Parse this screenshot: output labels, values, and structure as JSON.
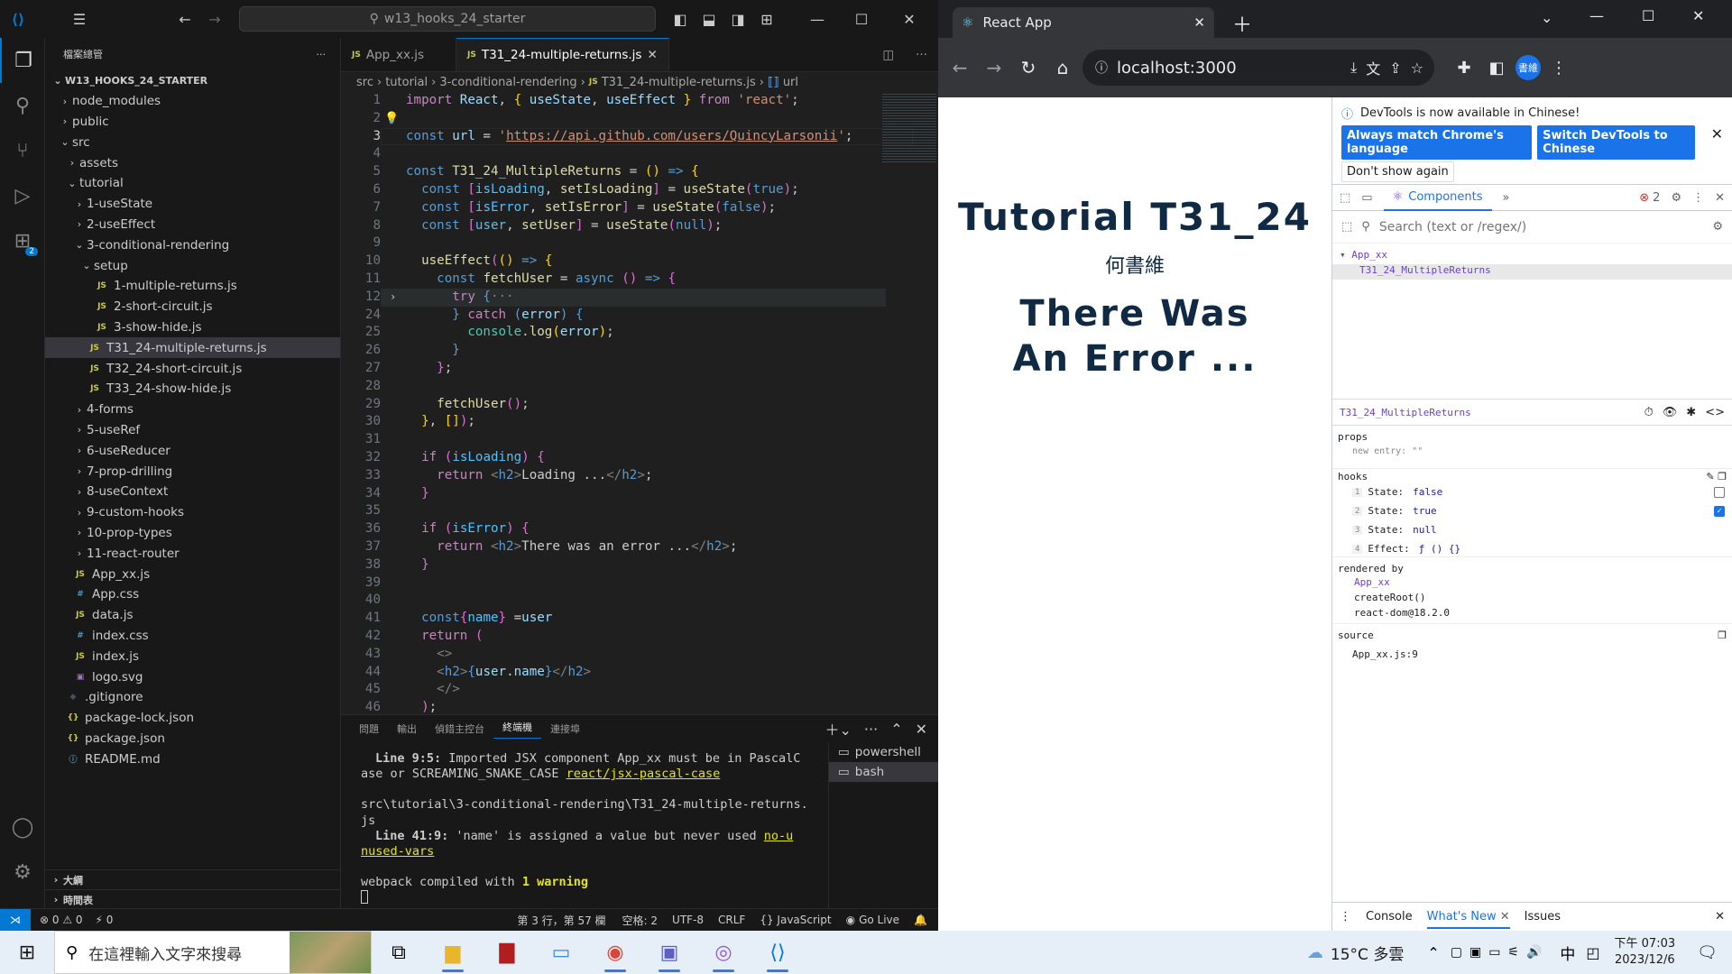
{
  "vscode": {
    "search": "w13_hooks_24_starter",
    "explorer_title": "檔案總管",
    "project": "W13_HOOKS_24_STARTER",
    "tree": [
      {
        "label": "node_modules",
        "indent": 1,
        "type": "folder",
        "open": false
      },
      {
        "label": "public",
        "indent": 1,
        "type": "folder",
        "open": false
      },
      {
        "label": "src",
        "indent": 1,
        "type": "folder",
        "open": true
      },
      {
        "label": "assets",
        "indent": 2,
        "type": "folder",
        "open": false
      },
      {
        "label": "tutorial",
        "indent": 2,
        "type": "folder",
        "open": true
      },
      {
        "label": "1-useState",
        "indent": 3,
        "type": "folder",
        "open": false
      },
      {
        "label": "2-useEffect",
        "indent": 3,
        "type": "folder",
        "open": false
      },
      {
        "label": "3-conditional-rendering",
        "indent": 3,
        "type": "folder",
        "open": true
      },
      {
        "label": "setup",
        "indent": 4,
        "type": "folder",
        "open": true
      },
      {
        "label": "1-multiple-returns.js",
        "indent": 5,
        "type": "js"
      },
      {
        "label": "2-short-circuit.js",
        "indent": 5,
        "type": "js"
      },
      {
        "label": "3-show-hide.js",
        "indent": 5,
        "type": "js"
      },
      {
        "label": "T31_24-multiple-returns.js",
        "indent": 4,
        "type": "js",
        "selected": true
      },
      {
        "label": "T32_24-short-circuit.js",
        "indent": 4,
        "type": "js"
      },
      {
        "label": "T33_24-show-hide.js",
        "indent": 4,
        "type": "js"
      },
      {
        "label": "4-forms",
        "indent": 3,
        "type": "folder",
        "open": false
      },
      {
        "label": "5-useRef",
        "indent": 3,
        "type": "folder",
        "open": false
      },
      {
        "label": "6-useReducer",
        "indent": 3,
        "type": "folder",
        "open": false
      },
      {
        "label": "7-prop-drilling",
        "indent": 3,
        "type": "folder",
        "open": false
      },
      {
        "label": "8-useContext",
        "indent": 3,
        "type": "folder",
        "open": false
      },
      {
        "label": "9-custom-hooks",
        "indent": 3,
        "type": "folder",
        "open": false
      },
      {
        "label": "10-prop-types",
        "indent": 3,
        "type": "folder",
        "open": false
      },
      {
        "label": "11-react-router",
        "indent": 3,
        "type": "folder",
        "open": false
      },
      {
        "label": "App_xx.js",
        "indent": 2,
        "type": "js"
      },
      {
        "label": "App.css",
        "indent": 2,
        "type": "css"
      },
      {
        "label": "data.js",
        "indent": 2,
        "type": "js"
      },
      {
        "label": "index.css",
        "indent": 2,
        "type": "css"
      },
      {
        "label": "index.js",
        "indent": 2,
        "type": "js"
      },
      {
        "label": "logo.svg",
        "indent": 2,
        "type": "svg"
      },
      {
        "label": ".gitignore",
        "indent": 1,
        "type": "git"
      },
      {
        "label": "package-lock.json",
        "indent": 1,
        "type": "json"
      },
      {
        "label": "package.json",
        "indent": 1,
        "type": "json"
      },
      {
        "label": "README.md",
        "indent": 1,
        "type": "info"
      }
    ],
    "outline": "大綱",
    "timeline": "時間表",
    "tabs": [
      "App_xx.js",
      "T31_24-multiple-returns.js"
    ],
    "breadcrumb": [
      "src",
      "tutorial",
      "3-conditional-rendering",
      "T31_24-multiple-returns.js",
      "url"
    ],
    "line_numbers": [
      "1",
      "2",
      "3",
      "4",
      "5",
      "6",
      "7",
      "8",
      "9",
      "10",
      "11",
      "12",
      "24",
      "25",
      "26",
      "27",
      "28",
      "29",
      "30",
      "31",
      "32",
      "33",
      "34",
      "35",
      "36",
      "37",
      "38",
      "39",
      "40",
      "41",
      "42",
      "43",
      "44",
      "45",
      "46"
    ],
    "panel_tabs": [
      "問題",
      "輸出",
      "偵錯主控台",
      "終端機",
      "連接埠"
    ],
    "terminal": {
      "l1a": "Line 9:5:",
      "l1b": "  Imported JSX component App_xx must be in PascalC",
      "l2a": "ase or SCREAMING_SNAKE_CASE  ",
      "l2b": "react/jsx-pascal-case",
      "l3": "src\\tutorial\\3-conditional-rendering\\T31_24-multiple-returns.",
      "l4": "js",
      "l5a": "Line 41:9:",
      "l5b": "  'name' is assigned a value but never used  ",
      "l5c": "no-u",
      "l6": "nused-vars",
      "l7a": "webpack compiled with ",
      "l7b": "1 warning"
    },
    "terminals": [
      "powershell",
      "bash"
    ],
    "status": {
      "problems": "⊗ 0 ⚠ 0",
      "ports": "⚡ 0",
      "position": "第 3 行，第 57 欄",
      "spaces": "空格: 2",
      "encoding": "UTF-8",
      "eol": "CRLF",
      "language": "{} JavaScript",
      "golive": "Go Live"
    }
  },
  "chrome": {
    "tab_title": "React App",
    "url": "localhost:3000",
    "profile": "書維",
    "page_title": "Tutorial T31_24",
    "page_author": "何書維",
    "page_error": "There Was An Error ...",
    "devtools": {
      "notice": "DevTools is now available in Chinese!",
      "btn1": "Always match Chrome's language",
      "btn2": "Switch DevTools to Chinese",
      "btn3": "Don't show again",
      "panel": "Components",
      "errors": "2",
      "search_placeholder": "Search (text or /regex/)",
      "tree_root": "App_xx",
      "tree_child": "T31_24_MultipleReturns",
      "selected": "T31_24_MultipleReturns",
      "props_label": "props",
      "props_entry": "new entry: \"\"",
      "hooks_label": "hooks",
      "hooks": [
        {
          "n": "1",
          "k": "State:",
          "v": "false",
          "checkbox": false
        },
        {
          "n": "2",
          "k": "State:",
          "v": "true",
          "checkbox": true
        },
        {
          "n": "3",
          "k": "State:",
          "v": "null"
        },
        {
          "n": "4",
          "k": "Effect:",
          "v": "ƒ () {}"
        }
      ],
      "rendered_label": "rendered by",
      "rendered": [
        "App_xx",
        "createRoot()",
        "react-dom@18.2.0"
      ],
      "source_label": "source",
      "source": "App_xx.js:9",
      "drawer_tabs": [
        "Console",
        "What's New",
        "Issues"
      ]
    }
  },
  "taskbar": {
    "search_placeholder": "在這裡輸入文字來搜尋",
    "weather": "15°C  多雲",
    "ime": "中",
    "time": "下午 07:03",
    "date": "2023/12/6"
  }
}
